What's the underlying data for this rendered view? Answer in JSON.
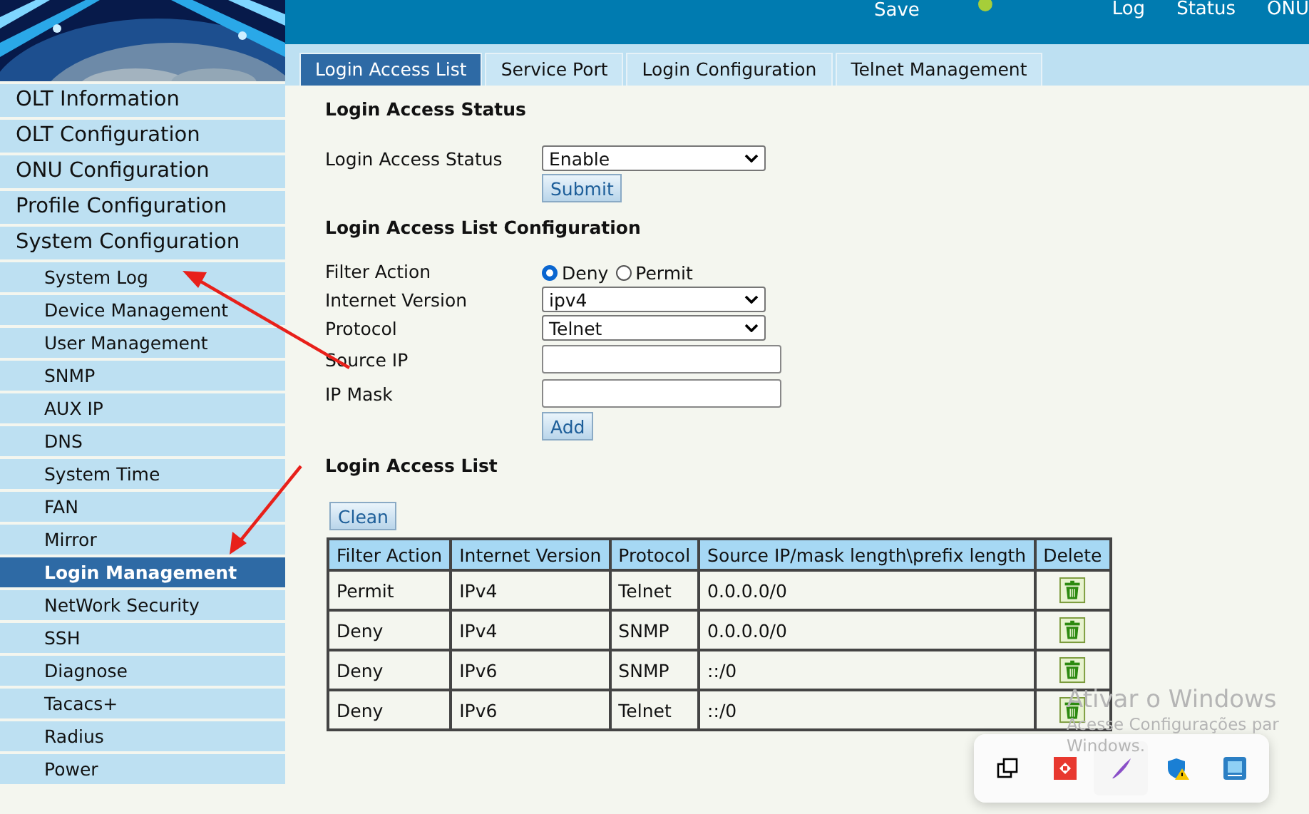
{
  "header": {
    "actions": [
      {
        "label": "Save"
      }
    ],
    "nav": [
      {
        "label": "Log"
      },
      {
        "label": "Status"
      },
      {
        "label": "ONU"
      }
    ]
  },
  "sidebar": {
    "items": [
      {
        "label": "OLT Information",
        "selected": false
      },
      {
        "label": "OLT Configuration",
        "selected": false
      },
      {
        "label": "ONU Configuration",
        "selected": false
      },
      {
        "label": "Profile Configuration",
        "selected": false
      },
      {
        "label": "System Configuration",
        "selected": false,
        "children": [
          {
            "label": "System Log",
            "selected": false
          },
          {
            "label": "Device Management",
            "selected": false
          },
          {
            "label": "User Management",
            "selected": false
          },
          {
            "label": "SNMP",
            "selected": false
          },
          {
            "label": "AUX IP",
            "selected": false
          },
          {
            "label": "DNS",
            "selected": false
          },
          {
            "label": "System Time",
            "selected": false
          },
          {
            "label": "FAN",
            "selected": false
          },
          {
            "label": "Mirror",
            "selected": false
          },
          {
            "label": "Login Management",
            "selected": true
          },
          {
            "label": "NetWork Security",
            "selected": false
          },
          {
            "label": "SSH",
            "selected": false
          },
          {
            "label": "Diagnose",
            "selected": false
          },
          {
            "label": "Tacacs+",
            "selected": false
          },
          {
            "label": "Radius",
            "selected": false
          },
          {
            "label": "Power",
            "selected": false
          }
        ]
      }
    ]
  },
  "tabs": [
    {
      "label": "Login Access List",
      "selected": true
    },
    {
      "label": "Service Port",
      "selected": false
    },
    {
      "label": "Login Configuration",
      "selected": false
    },
    {
      "label": "Telnet Management",
      "selected": false
    }
  ],
  "sections": [
    {
      "title": "Login Access Status",
      "fields": [
        {
          "kind": "select",
          "label": "Login Access Status",
          "value": "Enable"
        }
      ],
      "button": "Submit"
    },
    {
      "title": "Login Access List Configuration",
      "fields": [
        {
          "kind": "radio",
          "label": "Filter Action",
          "options": [
            {
              "label": "Deny",
              "selected": true
            },
            {
              "label": "Permit",
              "selected": false
            }
          ]
        },
        {
          "kind": "select",
          "label": "Internet Version",
          "value": "ipv4"
        },
        {
          "kind": "select",
          "label": "Protocol",
          "value": "Telnet"
        },
        {
          "kind": "text",
          "label": "Source IP"
        },
        {
          "kind": "text",
          "label": "IP Mask"
        }
      ],
      "button": "Add"
    },
    {
      "title": "Login Access List",
      "button": "Clean",
      "table": {
        "columns": [
          "Filter Action",
          "Internet Version",
          "Protocol",
          "Source IP/mask length\\prefix length",
          "Delete"
        ],
        "rows": [
          [
            "Permit",
            "IPv4",
            "Telnet",
            "0.0.0.0/0"
          ],
          [
            "Deny",
            "IPv4",
            "SNMP",
            "0.0.0.0/0"
          ],
          [
            "Deny",
            "IPv6",
            "SNMP",
            "::/0"
          ],
          [
            "Deny",
            "IPv6",
            "Telnet",
            "::/0"
          ]
        ]
      }
    }
  ],
  "watermark": {
    "title": "Ativar o Windows",
    "lines": [
      "Acesse Configurações par",
      "Windows."
    ]
  }
}
